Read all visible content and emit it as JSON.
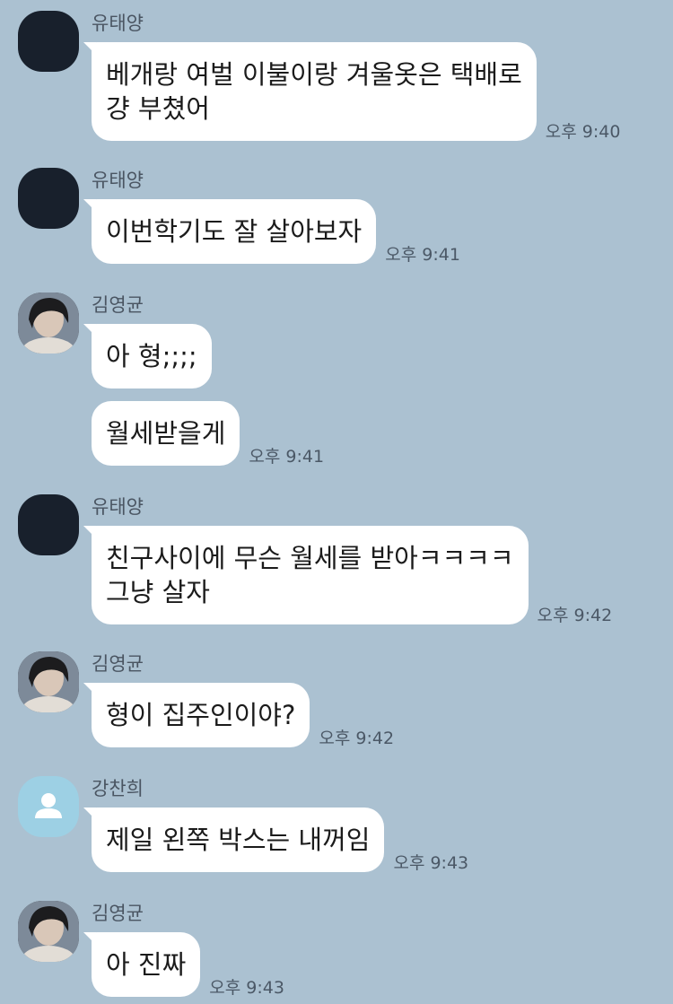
{
  "messages": [
    {
      "sender": "유태양",
      "avatar": "dark-avatar",
      "bubbles": [
        {
          "lines": [
            "베개랑 여벌 이불이랑 겨울옷은 택배로",
            "걍 부쳤어"
          ]
        }
      ],
      "time": "오후 9:40"
    },
    {
      "sender": "유태양",
      "avatar": "dark-avatar",
      "bubbles": [
        {
          "lines": [
            "이번학기도 잘 살아보자"
          ]
        }
      ],
      "time": "오후 9:41"
    },
    {
      "sender": "김영균",
      "avatar": "photo-avatar",
      "bubbles": [
        {
          "lines": [
            "아 형;;;;"
          ]
        },
        {
          "lines": [
            "월세받을게"
          ]
        }
      ],
      "time": "오후 9:41"
    },
    {
      "sender": "유태양",
      "avatar": "dark-avatar",
      "bubbles": [
        {
          "lines": [
            "친구사이에 무슨 월세를 받아ㅋㅋㅋㅋ",
            "그냥 살자"
          ]
        }
      ],
      "time": "오후 9:42"
    },
    {
      "sender": "김영균",
      "avatar": "photo-avatar",
      "bubbles": [
        {
          "lines": [
            "형이 집주인이야?"
          ]
        }
      ],
      "time": "오후 9:42"
    },
    {
      "sender": "강찬희",
      "avatar": "default-user-icon",
      "bubbles": [
        {
          "lines": [
            "제일 왼쪽 박스는 내꺼임"
          ]
        }
      ],
      "time": "오후 9:43"
    },
    {
      "sender": "김영균",
      "avatar": "photo-avatar",
      "bubbles": [
        {
          "lines": [
            "아 진짜"
          ]
        }
      ],
      "time": "오후 9:43"
    }
  ],
  "colors": {
    "background": "#abc1d1",
    "bubble": "#ffffff",
    "dark_avatar": "#18202c",
    "default_avatar": "#9dd0e4"
  }
}
